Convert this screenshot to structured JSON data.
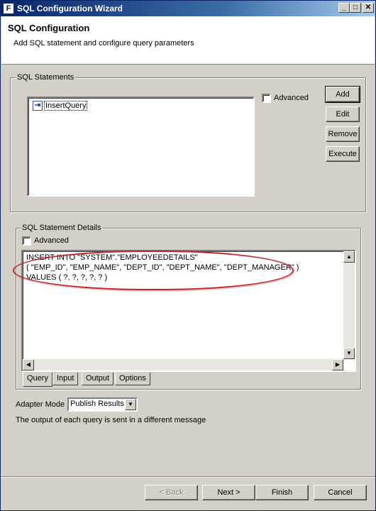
{
  "window": {
    "title": "SQL Configuration Wizard",
    "app_icon": "F",
    "controls": {
      "minimize": "_",
      "maximize": "□",
      "close": "✕"
    }
  },
  "header": {
    "title": "SQL Configuration",
    "subtitle": "Add SQL statement and configure query parameters"
  },
  "sql_statements": {
    "group_label": "SQL Statements",
    "items": [
      {
        "label": "InsertQuery",
        "icon": "query-icon"
      }
    ],
    "advanced_label": "Advanced",
    "advanced_checked": false,
    "buttons": {
      "add": "Add",
      "edit": "Edit",
      "remove": "Remove",
      "execute": "Execute"
    }
  },
  "details": {
    "group_label": "SQL Statement Details",
    "advanced_label": "Advanced",
    "advanced_checked": false,
    "sql_lines": [
      "INSERT INTO \"SYSTEM\".\"EMPLOYEEDETAILS\"",
      "( \"EMP_ID\", \"EMP_NAME\", \"DEPT_ID\", \"DEPT_NAME\", \"DEPT_MANAGER\" )",
      "VALUES ( ?, ?, ?, ?, ? )"
    ],
    "tabs": [
      "Query",
      "Input",
      "Output",
      "Options"
    ],
    "active_tab": "Query"
  },
  "adapter": {
    "label": "Adapter Mode",
    "value": "Publish Results",
    "description": "The output of each query is sent in a different message"
  },
  "footer": {
    "back": "< Back",
    "next": "Next >",
    "finish": "Finish",
    "cancel": "Cancel"
  },
  "colors": {
    "highlight": "#c0282c",
    "titlebar": "#0a246a",
    "face": "#d4d0c8"
  }
}
